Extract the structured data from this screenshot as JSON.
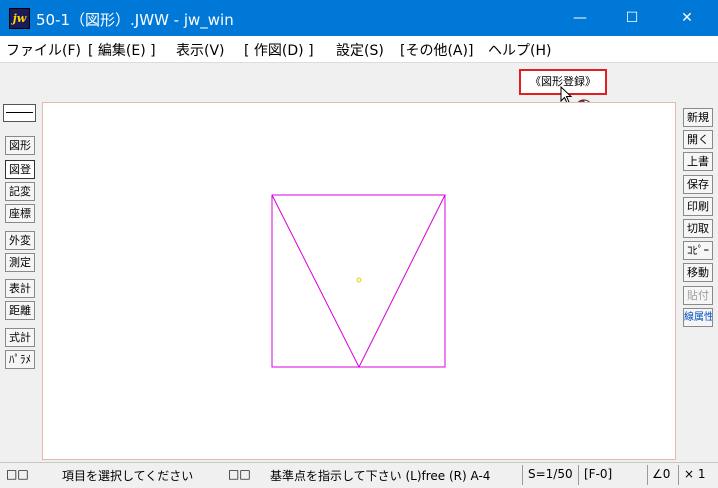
{
  "window": {
    "app_icon_text": "jw",
    "title": "50-1（図形）.JWW - jw_win",
    "minimize_glyph": "—",
    "maximize_glyph": "☐",
    "close_glyph": "✕"
  },
  "menu": {
    "items": [
      {
        "label": "ファイル(F)"
      },
      {
        "label": "[ 編集(E) ]"
      },
      {
        "label": "表示(V)"
      },
      {
        "label": "[ 作図(D) ]"
      },
      {
        "label": "設定(S)"
      },
      {
        "label": "[その他(A)]"
      },
      {
        "label": "ヘルプ(H)"
      }
    ]
  },
  "toolbar": {
    "register_button_label": "《図形登録》"
  },
  "left_tools": {
    "items": [
      {
        "label": "図形"
      },
      {
        "label": "図登"
      },
      {
        "label": "記変"
      },
      {
        "label": "座標"
      },
      {
        "label": "外変"
      },
      {
        "label": "測定"
      },
      {
        "label": "表計"
      },
      {
        "label": "距離"
      },
      {
        "label": "式計"
      },
      {
        "label": "ﾊﾟﾗﾒ"
      }
    ]
  },
  "right_tools": {
    "items": [
      {
        "label": "新規"
      },
      {
        "label": "開く"
      },
      {
        "label": "上書"
      },
      {
        "label": "保存"
      },
      {
        "label": "印刷"
      },
      {
        "label": "切取"
      },
      {
        "label": "ｺﾋﾟｰ"
      },
      {
        "label": "移動"
      },
      {
        "label": "貼付"
      },
      {
        "label": "線属性"
      }
    ]
  },
  "statusbar": {
    "icon_a": "□□",
    "message": "項目を選択してください",
    "icon_b": "□□",
    "hint": "基準点を指示して下さい (L)free (R) A-4",
    "scale": "S=1/50",
    "layer": "[F-0]",
    "angle": "∠0",
    "zoom": "× 1"
  },
  "colors": {
    "titlebar": "#0078d7",
    "drawing": "#d800d8",
    "highlight": "#e02020"
  }
}
